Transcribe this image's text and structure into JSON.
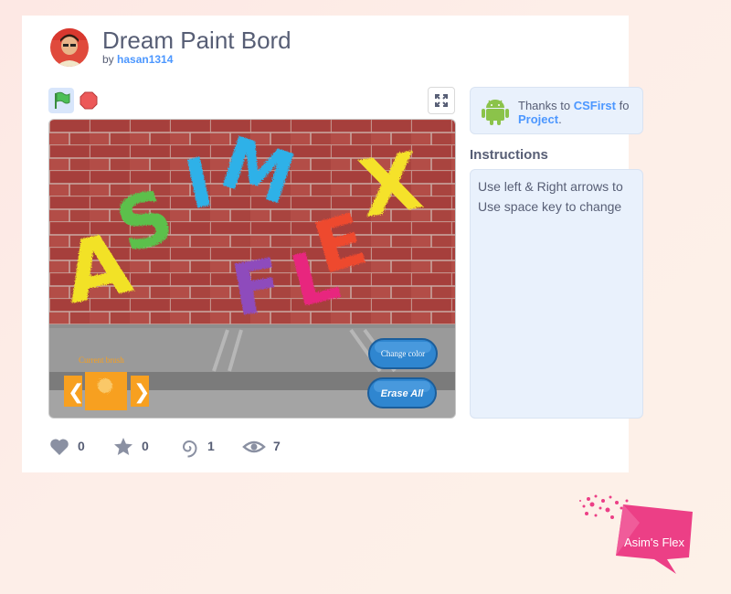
{
  "project": {
    "title": "Dream Paint Bord",
    "by_prefix": "by",
    "author": "hasan1314"
  },
  "sidebar": {
    "thanks_prefix": "Thanks to",
    "thanks_link": "CSFirst",
    "thanks_suffix": "fo",
    "thanks_link2": "Project",
    "thanks_end": ".",
    "instructions_heading": "Instructions",
    "instructions_lines": [
      "Use left & Right arrows to",
      "Use space key to change"
    ]
  },
  "stage": {
    "graffiti_letters": [
      "A",
      "S",
      "I",
      "M",
      "F",
      "L",
      "E",
      "X"
    ],
    "current_brush_label": "Current brush",
    "change_color_label": "Change color",
    "erase_all_label": "Erase All",
    "prev_arrow": "❮",
    "next_arrow": "❯"
  },
  "stats": {
    "loves": "0",
    "favorites": "0",
    "remixes": "1",
    "views": "7"
  },
  "watermark": {
    "text": "Asim's Flex"
  },
  "colors": {
    "brand_text": "#575e75",
    "link_blue": "#4c97ff",
    "flag_green": "#4cbf56",
    "stop_red": "#ec5959",
    "brick": "#a94140",
    "stage_button": "#2f86d0",
    "brush_orange": "#f7a020",
    "watermark_pink": "#ec3f86"
  },
  "icons": [
    "green-flag-icon",
    "stop-icon",
    "fullscreen-icon",
    "android-icon",
    "heart-icon",
    "star-icon",
    "remix-icon",
    "eye-icon"
  ]
}
